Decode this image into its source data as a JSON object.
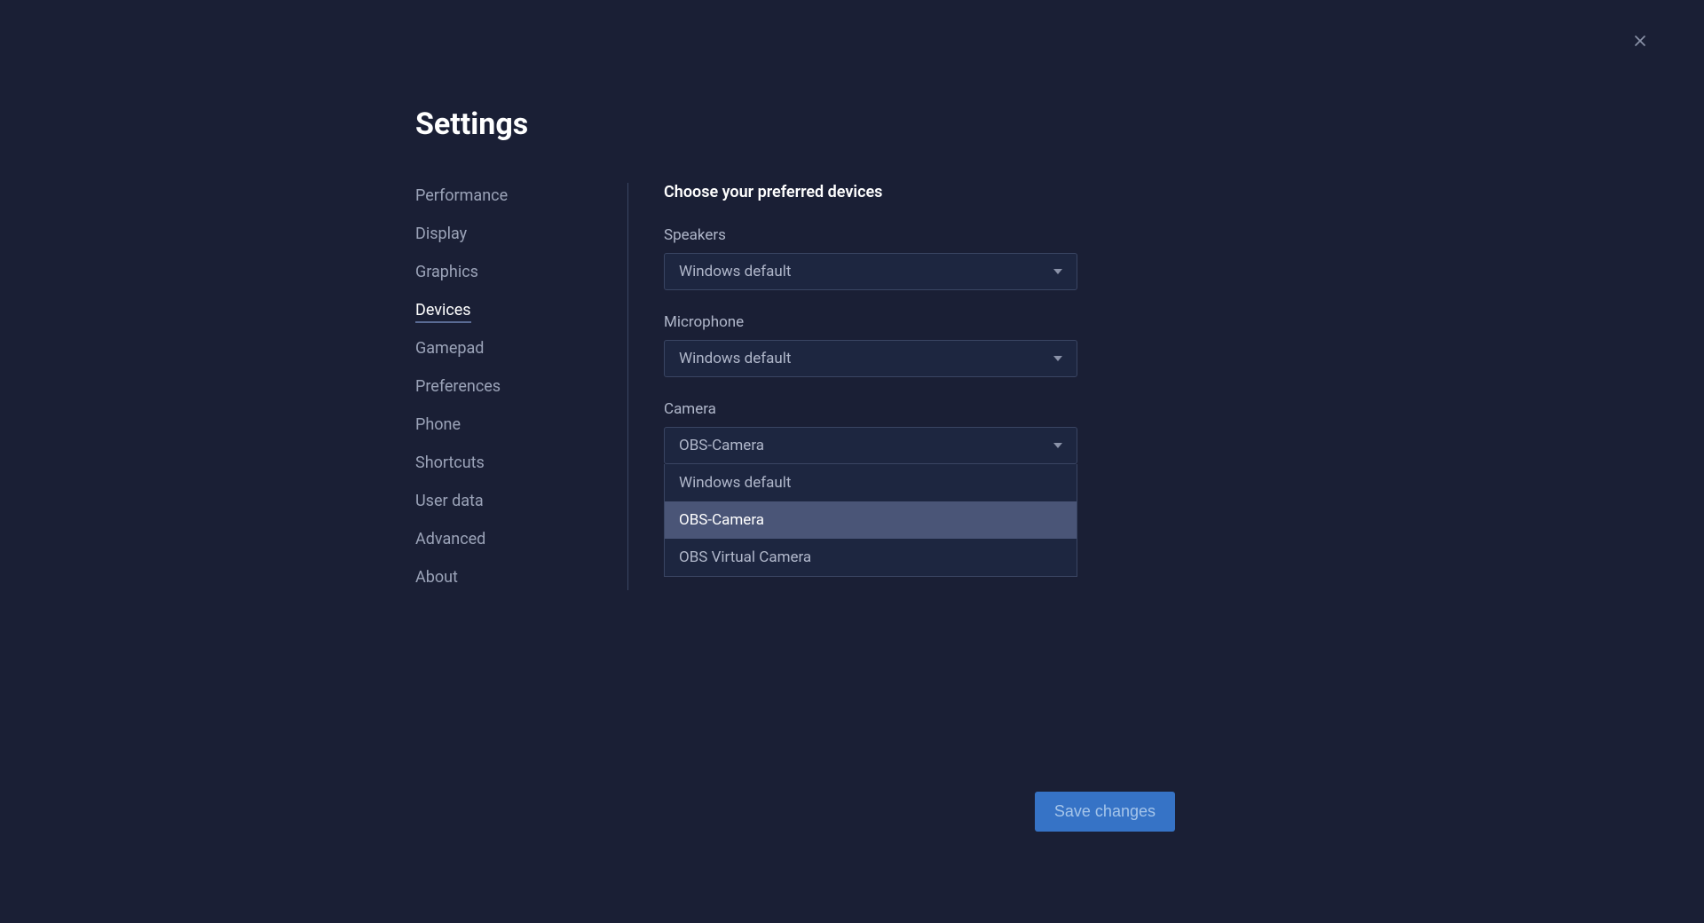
{
  "page_title": "Settings",
  "close_icon": "close",
  "sidebar": {
    "items": [
      {
        "label": "Performance",
        "active": false
      },
      {
        "label": "Display",
        "active": false
      },
      {
        "label": "Graphics",
        "active": false
      },
      {
        "label": "Devices",
        "active": true
      },
      {
        "label": "Gamepad",
        "active": false
      },
      {
        "label": "Preferences",
        "active": false
      },
      {
        "label": "Phone",
        "active": false
      },
      {
        "label": "Shortcuts",
        "active": false
      },
      {
        "label": "User data",
        "active": false
      },
      {
        "label": "Advanced",
        "active": false
      },
      {
        "label": "About",
        "active": false
      }
    ]
  },
  "content": {
    "heading": "Choose your preferred devices",
    "speakers": {
      "label": "Speakers",
      "value": "Windows default"
    },
    "microphone": {
      "label": "Microphone",
      "value": "Windows default"
    },
    "camera": {
      "label": "Camera",
      "value": "OBS-Camera",
      "options": [
        {
          "label": "Windows default",
          "highlighted": false
        },
        {
          "label": "OBS-Camera",
          "highlighted": true
        },
        {
          "label": "OBS Virtual Camera",
          "highlighted": false
        }
      ]
    }
  },
  "save_button_label": "Save changes"
}
